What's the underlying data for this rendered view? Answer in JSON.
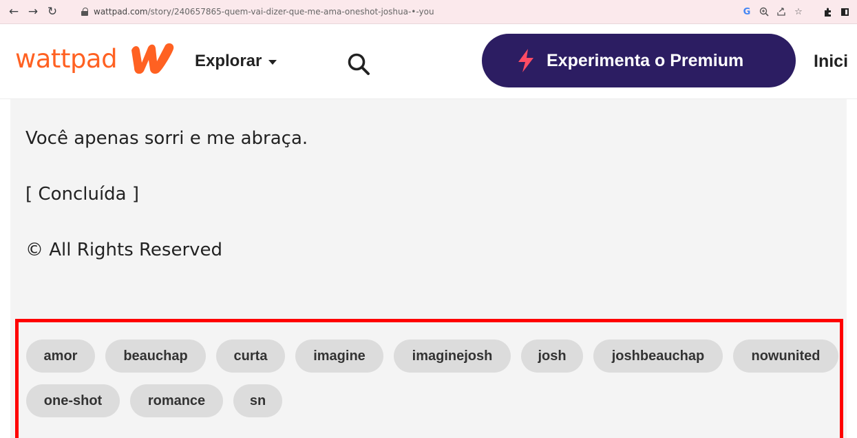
{
  "browser": {
    "url_domain": "wattpad.com",
    "url_path": "/story/240657865-quem-vai-dizer-que-me-ama-oneshot-joshua-•-you",
    "back_icon": "arrow-left-icon",
    "forward_icon": "arrow-right-icon",
    "reload_icon": "reload-icon"
  },
  "header": {
    "logo_text": "wattpad",
    "explorar_label": "Explorar",
    "premium_label": "Experimenta o Premium",
    "inicio_label": "Inici",
    "brand_color": "#ff6122",
    "premium_bg": "#2c1d62",
    "premium_icon_color": "#ff4c64"
  },
  "story": {
    "line1": "Você apenas sorri e me abraça.",
    "line2": "[ Concluída ]",
    "line3": "© All Rights Reserved"
  },
  "tags": [
    "amor",
    "beauchap",
    "curta",
    "imagine",
    "imaginejosh",
    "josh",
    "joshbeauchap",
    "nowunited",
    "one-shot",
    "romance",
    "sn"
  ]
}
